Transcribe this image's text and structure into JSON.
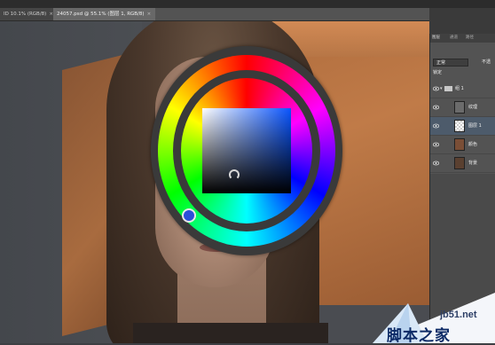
{
  "document_tabs": [
    {
      "label": "ID 10.1% (RGB/8)",
      "close": "×"
    },
    {
      "label": "24057.psd @ 55.1% (图层 1, RGB/8)",
      "close": "×"
    }
  ],
  "layers_panel": {
    "tabs": [
      "图层",
      "通道",
      "路径"
    ],
    "blend_mode": "正常",
    "opacity_label": "不透",
    "lock_label": "锁定",
    "layers": [
      {
        "name": "组 1",
        "type": "group",
        "visible": true,
        "expanded": true
      },
      {
        "name": "纹理",
        "type": "layer",
        "visible": true
      },
      {
        "name": "图层 1",
        "type": "layer",
        "visible": true,
        "selected": true
      },
      {
        "name": "颜色",
        "type": "layer",
        "visible": true
      },
      {
        "name": "背景",
        "type": "layer",
        "visible": true
      }
    ]
  },
  "color_picker": {
    "type": "hue-wheel",
    "selected_hue_color": "#2b4fd8",
    "square_color": "#0a55ff"
  },
  "watermark": {
    "domain": "jb51.net",
    "text": "脚本之家"
  }
}
